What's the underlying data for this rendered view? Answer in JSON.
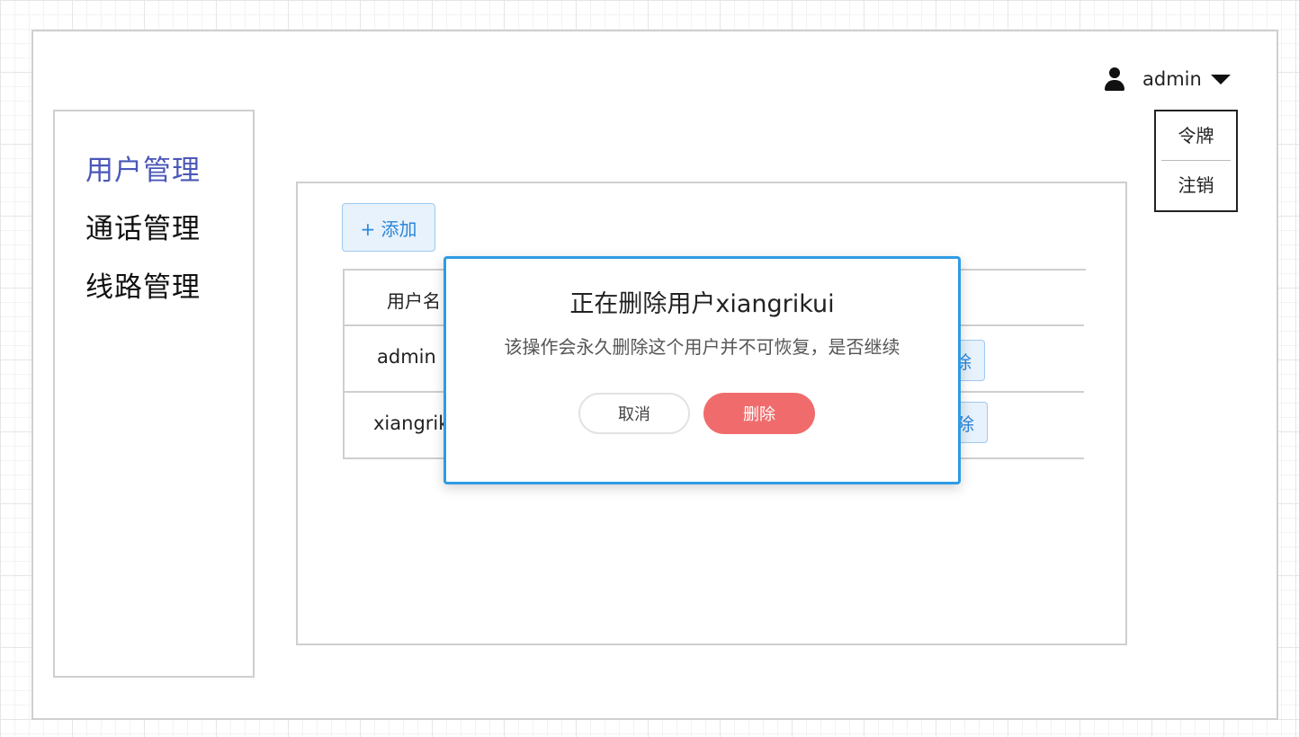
{
  "header": {
    "user_name": "admin",
    "icons": {
      "user": "user-icon",
      "caret": "caret-down-icon"
    },
    "dropdown": {
      "items": [
        "令牌",
        "注销"
      ]
    }
  },
  "sidebar": {
    "items": [
      {
        "label": "用户管理",
        "active": true
      },
      {
        "label": "通话管理",
        "active": false
      },
      {
        "label": "线路管理",
        "active": false
      }
    ],
    "active_color": "#4a57b8"
  },
  "main": {
    "add_button": "+ 添加",
    "table": {
      "header_visible": "用户名",
      "rows": [
        {
          "username": "admin",
          "action_partial": "除"
        },
        {
          "username": "xiangrikui",
          "action_partial": "除"
        }
      ]
    }
  },
  "dialog": {
    "title": "正在删除用户xiangrikui",
    "message": "该操作会永久删除这个用户并不可恢复，是否继续",
    "cancel_label": "取消",
    "delete_label": "删除",
    "border_color": "#2f9be4",
    "delete_color": "#f06c6c"
  }
}
